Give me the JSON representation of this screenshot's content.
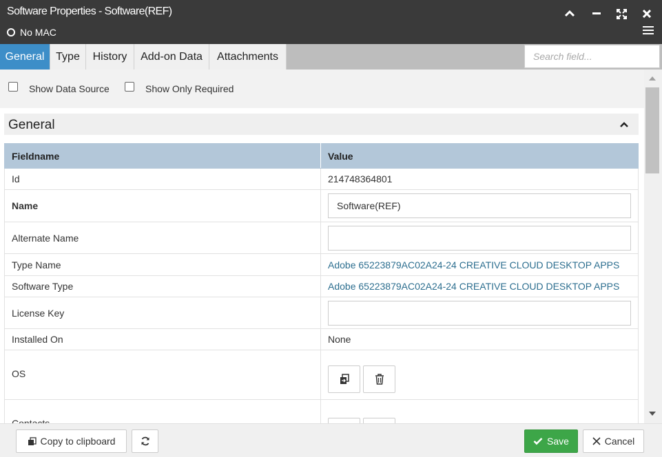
{
  "window": {
    "title": "Software Properties - Software(REF)",
    "status_text": "No MAC",
    "icons": [
      "chevron-up-icon",
      "minimize-icon",
      "maximize-icon",
      "close-icon",
      "hamburger-menu-icon"
    ]
  },
  "tabs": [
    {
      "label": "General",
      "active": true
    },
    {
      "label": "Type",
      "active": false
    },
    {
      "label": "History",
      "active": false
    },
    {
      "label": "Add-on Data",
      "active": false
    },
    {
      "label": "Attachments",
      "active": false
    }
  ],
  "search": {
    "placeholder": "Search field..."
  },
  "options": {
    "show_data_source": "Show Data Source",
    "show_only_required": "Show Only Required"
  },
  "section": {
    "title": "General",
    "col_fieldname": "Fieldname",
    "col_value": "Value"
  },
  "rows": {
    "id": {
      "label": "Id",
      "value": "214748364801"
    },
    "name": {
      "label": "Name",
      "value": "Software(REF)"
    },
    "alternate_name": {
      "label": "Alternate Name",
      "value": ""
    },
    "type_name": {
      "label": "Type Name",
      "value": "Adobe 65223879AC02A24-24 CREATIVE CLOUD DESKTOP APPS"
    },
    "software_type": {
      "label": "Software Type",
      "value": "Adobe 65223879AC02A24-24 CREATIVE CLOUD DESKTOP APPS"
    },
    "license_key": {
      "label": "License Key",
      "value": ""
    },
    "installed_on": {
      "label": "Installed On",
      "value": "None"
    },
    "os": {
      "label": "OS"
    },
    "contacts": {
      "label": "Contacts"
    }
  },
  "footer": {
    "copy_label": "Copy to clipboard",
    "save_label": "Save",
    "cancel_label": "Cancel"
  },
  "colors": {
    "accent": "#3d8ec8",
    "header_bg": "#3a3a3a",
    "table_header": "#b3c7d9",
    "link": "#2c6e8f",
    "save": "#3da648"
  }
}
